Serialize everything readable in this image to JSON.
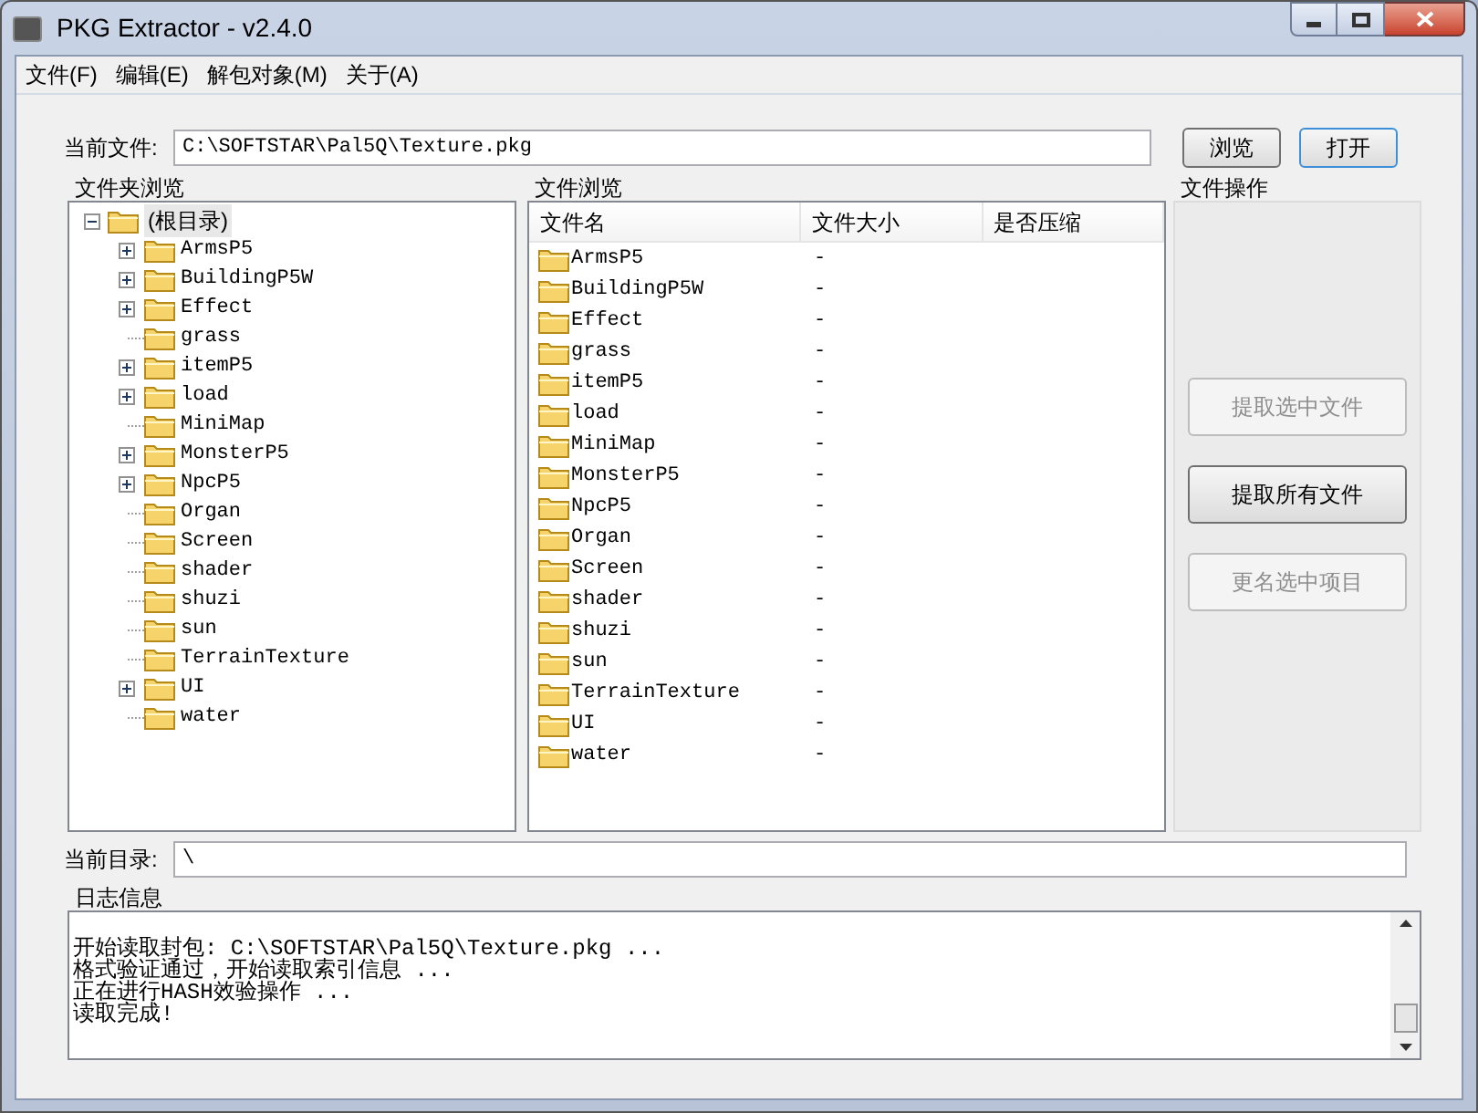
{
  "window": {
    "title": "PKG Extractor - v2.4.0"
  },
  "menu": [
    "文件(F)",
    "编辑(E)",
    "解包对象(M)",
    "关于(A)"
  ],
  "current_file": {
    "label": "当前文件:",
    "value": "C:\\SOFTSTAR\\Pal5Q\\Texture.pkg"
  },
  "file_buttons": [
    {
      "label": "浏览",
      "default": false
    },
    {
      "label": "打开",
      "default": true
    }
  ],
  "folder_tree": {
    "title": "文件夹浏览",
    "root": {
      "label": "(根目录)",
      "expanded": true,
      "selected": true,
      "children": [
        {
          "label": "ArmsP5",
          "expandable": true
        },
        {
          "label": "BuildingP5W",
          "expandable": true
        },
        {
          "label": "Effect",
          "expandable": true
        },
        {
          "label": "grass",
          "expandable": false
        },
        {
          "label": "itemP5",
          "expandable": true
        },
        {
          "label": "load",
          "expandable": true
        },
        {
          "label": "MiniMap",
          "expandable": false
        },
        {
          "label": "MonsterP5",
          "expandable": true
        },
        {
          "label": "NpcP5",
          "expandable": true
        },
        {
          "label": "Organ",
          "expandable": false
        },
        {
          "label": "Screen",
          "expandable": false
        },
        {
          "label": "shader",
          "expandable": false
        },
        {
          "label": "shuzi",
          "expandable": false
        },
        {
          "label": "sun",
          "expandable": false
        },
        {
          "label": "TerrainTexture",
          "expandable": false
        },
        {
          "label": "UI",
          "expandable": true
        },
        {
          "label": "water",
          "expandable": false
        }
      ]
    }
  },
  "file_list": {
    "title": "文件浏览",
    "columns": [
      "文件名",
      "文件大小",
      "是否压缩"
    ],
    "rows": [
      [
        "ArmsP5",
        "-"
      ],
      [
        "BuildingP5W",
        "-"
      ],
      [
        "Effect",
        "-"
      ],
      [
        "grass",
        "-"
      ],
      [
        "itemP5",
        "-"
      ],
      [
        "load",
        "-"
      ],
      [
        "MiniMap",
        "-"
      ],
      [
        "MonsterP5",
        "-"
      ],
      [
        "NpcP5",
        "-"
      ],
      [
        "Organ",
        "-"
      ],
      [
        "Screen",
        "-"
      ],
      [
        "shader",
        "-"
      ],
      [
        "shuzi",
        "-"
      ],
      [
        "sun",
        "-"
      ],
      [
        "TerrainTexture",
        "-"
      ],
      [
        "UI",
        "-"
      ],
      [
        "water",
        "-"
      ]
    ]
  },
  "file_ops": {
    "title": "文件操作",
    "buttons": [
      {
        "label": "提取选中文件",
        "disabled": true
      },
      {
        "label": "提取所有文件",
        "disabled": false
      },
      {
        "label": "更名选中项目",
        "disabled": true
      }
    ]
  },
  "current_dir": {
    "label": "当前目录:",
    "value": "\\"
  },
  "log": {
    "title": "日志信息",
    "lines": [
      "开始读取封包: C:\\SOFTSTAR\\Pal5Q\\Texture.pkg ...",
      "格式验证通过，开始读取索引信息 ...",
      "正在进行HASH效验操作 ...",
      "读取完成!"
    ]
  }
}
